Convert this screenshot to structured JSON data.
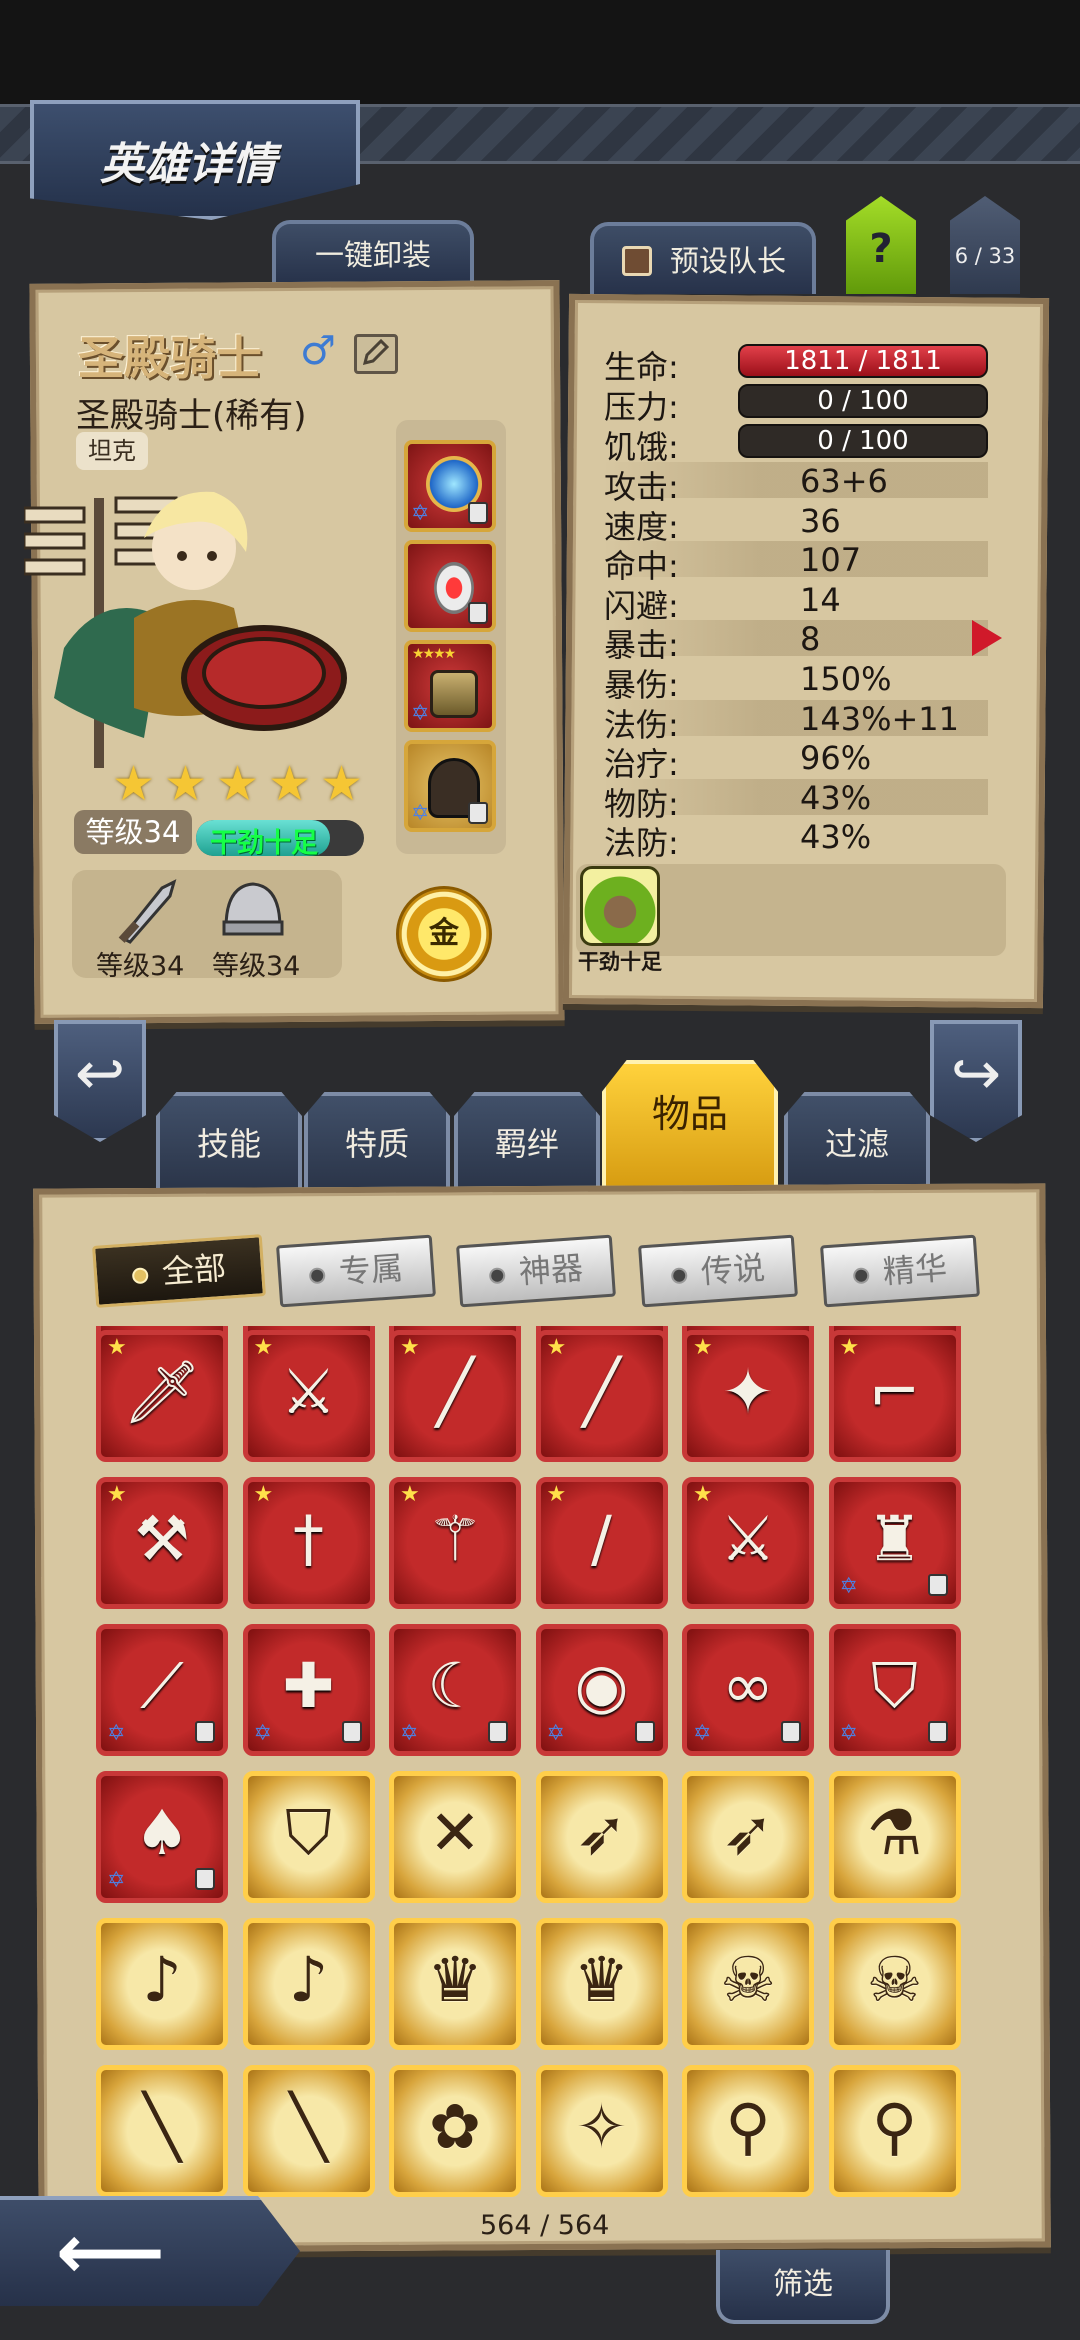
{
  "header": {
    "title": "英雄详情"
  },
  "buttons": {
    "unequip_all": "一键卸装",
    "preset_captain": "预设队长",
    "help": "?",
    "hero_count": "6 / 33",
    "filter": "筛选"
  },
  "hero": {
    "name": "圣殿骑士",
    "class_label": "圣殿骑士(稀有)",
    "role": "坦克",
    "stars": 5,
    "level": "等级34",
    "mood": "干劲十足",
    "mood_level": 0.8,
    "weapon_level": "等级34",
    "helmet_level": "等级34",
    "gold_badge": "金",
    "gender_icon": "male-symbol-icon"
  },
  "stats": {
    "hp": {
      "label": "生命:",
      "value": "1811 / 1811"
    },
    "stress": {
      "label": "压力:",
      "value": "0 / 100"
    },
    "hunger": {
      "label": "饥饿:",
      "value": "0 / 100"
    },
    "rows": [
      {
        "label": "攻击:",
        "value": "63+6"
      },
      {
        "label": "速度:",
        "value": "36"
      },
      {
        "label": "命中:",
        "value": "107"
      },
      {
        "label": "闪避:",
        "value": "14"
      },
      {
        "label": "暴击:",
        "value": "8"
      },
      {
        "label": "暴伤:",
        "value": "150%"
      },
      {
        "label": "法伤:",
        "value": "143%+11"
      },
      {
        "label": "治疗:",
        "value": "96%"
      },
      {
        "label": "物防:",
        "value": "43%"
      },
      {
        "label": "法防:",
        "value": "43%"
      }
    ]
  },
  "trait": {
    "label": "干劲十足"
  },
  "tabs": [
    {
      "label": "技能"
    },
    {
      "label": "特质"
    },
    {
      "label": "羁绊"
    },
    {
      "label": "物品",
      "active": true
    },
    {
      "label": "过滤"
    }
  ],
  "filters": [
    {
      "label": "全部",
      "active": true
    },
    {
      "label": "专属"
    },
    {
      "label": "神器"
    },
    {
      "label": "传说"
    },
    {
      "label": "精华"
    }
  ],
  "inventory": {
    "count": "564 / 564",
    "rows": [
      [
        {
          "icon": "cleaver-icon",
          "rarity": "red",
          "starred": true
        },
        {
          "icon": "broadsword-icon",
          "rarity": "red",
          "starred": true
        },
        {
          "icon": "katana-icon",
          "rarity": "red",
          "starred": true
        },
        {
          "icon": "katana-icon",
          "rarity": "red",
          "starred": true
        },
        {
          "icon": "spellbook-icon",
          "rarity": "red",
          "starred": true
        },
        {
          "icon": "pistol-icon",
          "rarity": "red",
          "starred": true
        }
      ],
      [
        {
          "icon": "battle-axe-icon",
          "rarity": "red",
          "starred": true
        },
        {
          "icon": "rapier-icon",
          "rarity": "red",
          "starred": true
        },
        {
          "icon": "staff-icon",
          "rarity": "red",
          "starred": true
        },
        {
          "icon": "cane-icon",
          "rarity": "red",
          "starred": true
        },
        {
          "icon": "golden-sword-icon",
          "rarity": "red",
          "starred": true
        },
        {
          "icon": "armor-icon",
          "rarity": "red",
          "locked": true
        }
      ],
      [
        {
          "icon": "blade-icon",
          "rarity": "red",
          "locked": true
        },
        {
          "icon": "war-sword-icon",
          "rarity": "red",
          "locked": true
        },
        {
          "icon": "green-dagger-icon",
          "rarity": "red",
          "locked": true
        },
        {
          "icon": "belt-icon",
          "rarity": "red",
          "locked": true
        },
        {
          "icon": "goggles-icon",
          "rarity": "red",
          "locked": true
        },
        {
          "icon": "shield-icon",
          "rarity": "red",
          "locked": true
        }
      ],
      [
        {
          "icon": "cloak-icon",
          "rarity": "red",
          "locked": true
        },
        {
          "icon": "shield-icon",
          "rarity": "gold"
        },
        {
          "icon": "crossed-daggers-icon",
          "rarity": "gold"
        },
        {
          "icon": "crossbow-icon",
          "rarity": "gold"
        },
        {
          "icon": "crossbow-icon",
          "rarity": "gold"
        },
        {
          "icon": "potion-ring-icon",
          "rarity": "gold"
        }
      ],
      [
        {
          "icon": "flute-icon",
          "rarity": "gold"
        },
        {
          "icon": "flute-icon",
          "rarity": "gold"
        },
        {
          "icon": "cape-icon",
          "rarity": "gold"
        },
        {
          "icon": "cape-icon",
          "rarity": "gold"
        },
        {
          "icon": "skull-banner-icon",
          "rarity": "gold"
        },
        {
          "icon": "skull-banner-icon",
          "rarity": "gold"
        }
      ],
      [
        {
          "icon": "rifle-icon",
          "rarity": "gold"
        },
        {
          "icon": "rifle-icon",
          "rarity": "gold"
        },
        {
          "icon": "feather-icon",
          "rarity": "gold"
        },
        {
          "icon": "wand-icon",
          "rarity": "gold"
        },
        {
          "icon": "orb-staff-icon",
          "rarity": "gold"
        },
        {
          "icon": "orb-staff-icon",
          "rarity": "gold"
        }
      ]
    ]
  }
}
